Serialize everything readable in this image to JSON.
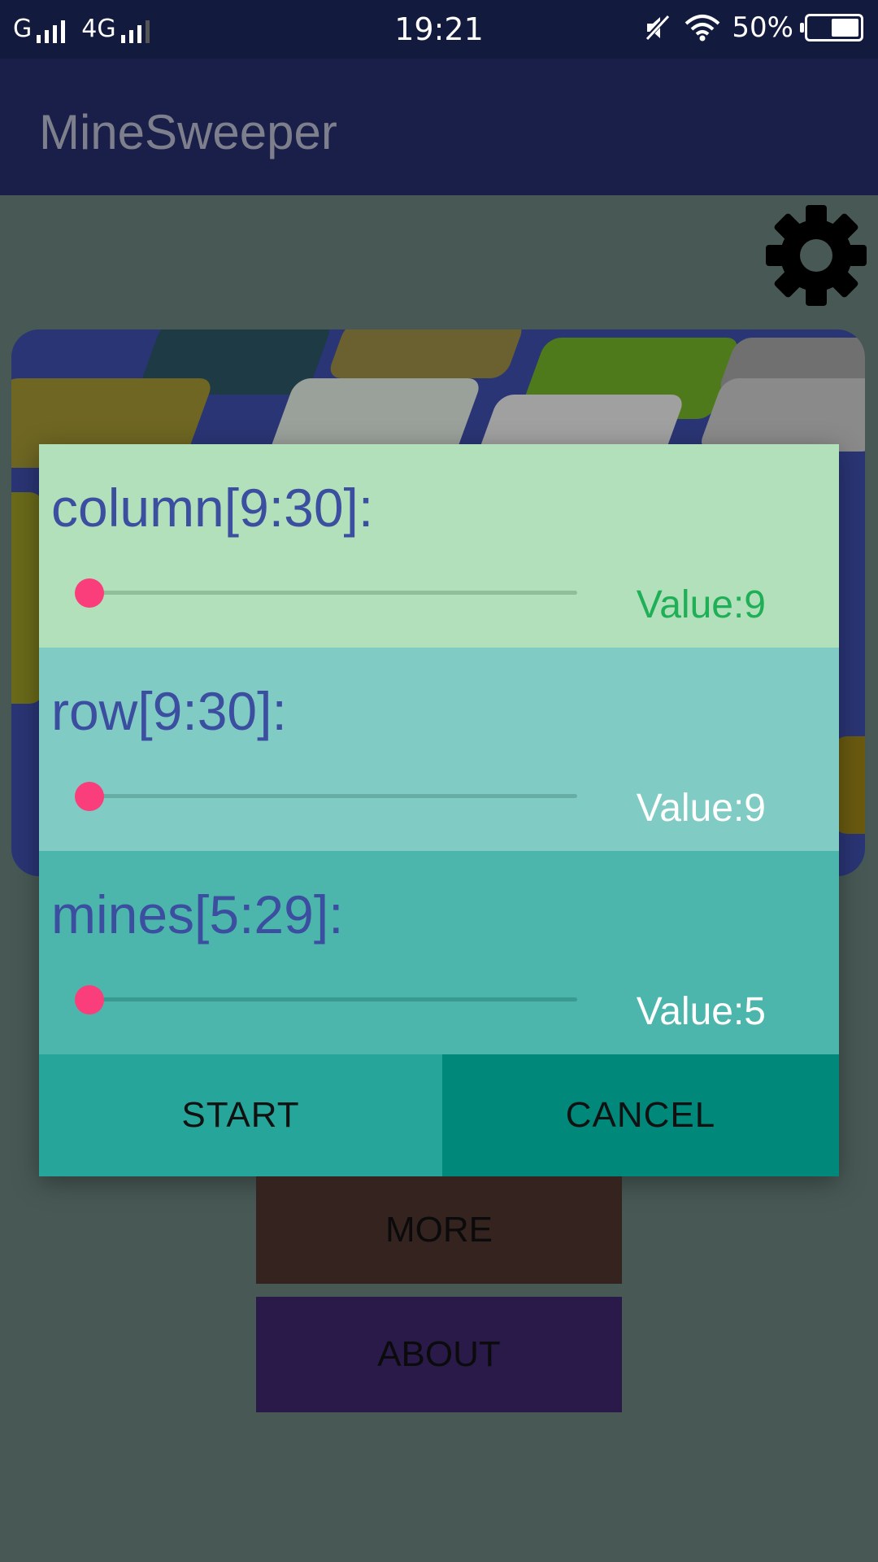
{
  "status_bar": {
    "carrier1": "G",
    "carrier2": "4G",
    "time": "19:21",
    "battery": "50%"
  },
  "app_bar": {
    "title": "MineSweeper"
  },
  "icons": {
    "settings": "gear-icon",
    "mute": "mute-icon",
    "wifi": "wifi-icon",
    "battery": "battery-icon"
  },
  "dialog": {
    "sliders": [
      {
        "label": "column[9:30]:",
        "value_text": "Value:9",
        "min": 9,
        "max": 30,
        "value": 9
      },
      {
        "label": "row[9:30]:",
        "value_text": "Value:9",
        "min": 9,
        "max": 30,
        "value": 9
      },
      {
        "label": "mines[5:29]:",
        "value_text": "Value:5",
        "min": 5,
        "max": 29,
        "value": 5
      }
    ],
    "start_label": "START",
    "cancel_label": "CANCEL"
  },
  "menu": {
    "more_label": "MORE",
    "about_label": "ABOUT"
  },
  "colors": {
    "accent": "#fa3d7b",
    "column_bg": "#b2e0bb",
    "row_bg": "#80cbc4",
    "mines_bg": "#4db6ac",
    "start_bg": "#26a69a",
    "cancel_bg": "#00897b",
    "more_bg": "#35231f",
    "about_bg": "#2a1a4a",
    "value_green": "#1faf57"
  }
}
